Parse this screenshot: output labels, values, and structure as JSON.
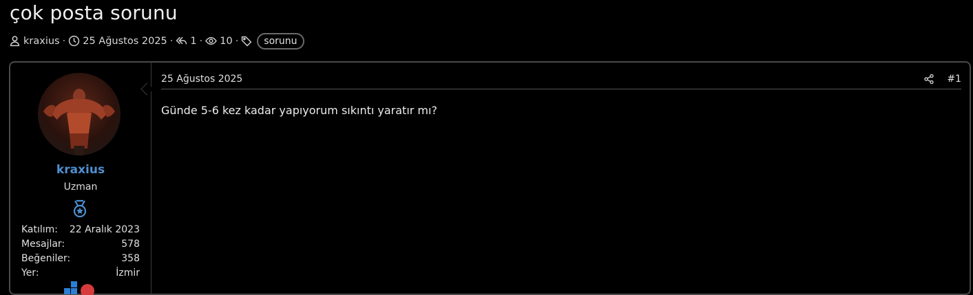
{
  "thread": {
    "title": "çok posta sorunu",
    "author": "kraxius",
    "date": "25 Ağustos 2025",
    "replies": "1",
    "views": "10",
    "tag": "sorunu"
  },
  "icons": {
    "author": "user-icon",
    "date": "clock-icon",
    "replies": "reply-icon",
    "views": "eye-icon",
    "tags": "tag-icon",
    "share": "share-icon"
  },
  "user": {
    "name": "kraxius",
    "title": "Uzman",
    "stats": [
      {
        "label": "Katılım:",
        "value": "22 Aralık 2023"
      },
      {
        "label": "Mesajlar:",
        "value": "578"
      },
      {
        "label": "Beğeniler:",
        "value": "358"
      },
      {
        "label": "Yer:",
        "value": "İzmir"
      }
    ]
  },
  "post": {
    "date": "25 Ağustos 2025",
    "number": "#1",
    "content": "Günde 5-6 kez kadar yapıyorum sıkıntı yaratır mı?"
  },
  "colors": {
    "background": "#000000",
    "username": "#4f8fd0",
    "border": "#4a4a4a"
  }
}
